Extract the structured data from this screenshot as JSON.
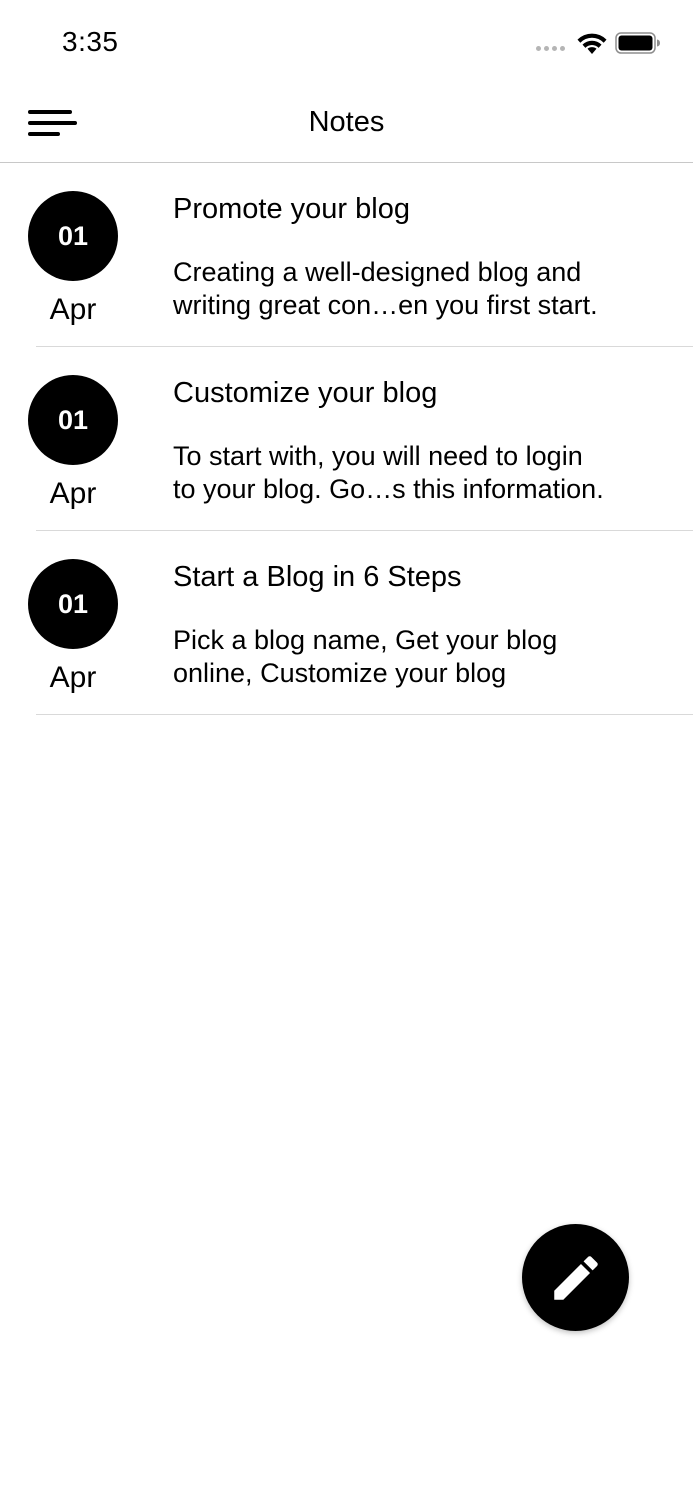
{
  "status_bar": {
    "time": "3:35",
    "icons": [
      "signal-dots-icon",
      "wifi-icon",
      "battery-icon"
    ]
  },
  "nav": {
    "menu_icon": "hamburger-menu-icon",
    "title": "Notes"
  },
  "notes": [
    {
      "day": "01",
      "month": "Apr",
      "title": "Promote your blog",
      "body": "Creating a well-designed blog and\nwriting great con…en you first start."
    },
    {
      "day": "01",
      "month": "Apr",
      "title": "Customize your blog",
      "body": "To start with, you will need to login\nto your blog. Go…s this information."
    },
    {
      "day": "01",
      "month": "Apr",
      "title": "Start a Blog in 6 Steps",
      "body": "Pick a blog name, Get your blog\nonline, Customize your blog"
    }
  ],
  "fab": {
    "icon": "pencil-icon"
  },
  "colors": {
    "background": "#ffffff",
    "primary": "#000000",
    "divider": "#d9d9d9",
    "date_text": "#ffffff"
  }
}
